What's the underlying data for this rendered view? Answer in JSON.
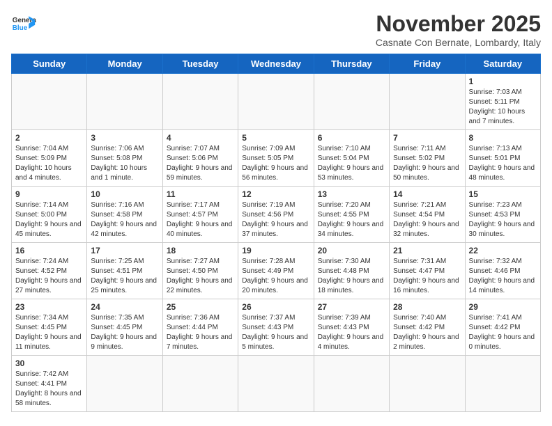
{
  "header": {
    "logo_general": "General",
    "logo_blue": "Blue",
    "month": "November 2025",
    "location": "Casnate Con Bernate, Lombardy, Italy"
  },
  "days_of_week": [
    "Sunday",
    "Monday",
    "Tuesday",
    "Wednesday",
    "Thursday",
    "Friday",
    "Saturday"
  ],
  "weeks": [
    [
      {
        "day": "",
        "info": ""
      },
      {
        "day": "",
        "info": ""
      },
      {
        "day": "",
        "info": ""
      },
      {
        "day": "",
        "info": ""
      },
      {
        "day": "",
        "info": ""
      },
      {
        "day": "",
        "info": ""
      },
      {
        "day": "1",
        "info": "Sunrise: 7:03 AM\nSunset: 5:11 PM\nDaylight: 10 hours and 7 minutes."
      }
    ],
    [
      {
        "day": "2",
        "info": "Sunrise: 7:04 AM\nSunset: 5:09 PM\nDaylight: 10 hours and 4 minutes."
      },
      {
        "day": "3",
        "info": "Sunrise: 7:06 AM\nSunset: 5:08 PM\nDaylight: 10 hours and 1 minute."
      },
      {
        "day": "4",
        "info": "Sunrise: 7:07 AM\nSunset: 5:06 PM\nDaylight: 9 hours and 59 minutes."
      },
      {
        "day": "5",
        "info": "Sunrise: 7:09 AM\nSunset: 5:05 PM\nDaylight: 9 hours and 56 minutes."
      },
      {
        "day": "6",
        "info": "Sunrise: 7:10 AM\nSunset: 5:04 PM\nDaylight: 9 hours and 53 minutes."
      },
      {
        "day": "7",
        "info": "Sunrise: 7:11 AM\nSunset: 5:02 PM\nDaylight: 9 hours and 50 minutes."
      },
      {
        "day": "8",
        "info": "Sunrise: 7:13 AM\nSunset: 5:01 PM\nDaylight: 9 hours and 48 minutes."
      }
    ],
    [
      {
        "day": "9",
        "info": "Sunrise: 7:14 AM\nSunset: 5:00 PM\nDaylight: 9 hours and 45 minutes."
      },
      {
        "day": "10",
        "info": "Sunrise: 7:16 AM\nSunset: 4:58 PM\nDaylight: 9 hours and 42 minutes."
      },
      {
        "day": "11",
        "info": "Sunrise: 7:17 AM\nSunset: 4:57 PM\nDaylight: 9 hours and 40 minutes."
      },
      {
        "day": "12",
        "info": "Sunrise: 7:19 AM\nSunset: 4:56 PM\nDaylight: 9 hours and 37 minutes."
      },
      {
        "day": "13",
        "info": "Sunrise: 7:20 AM\nSunset: 4:55 PM\nDaylight: 9 hours and 34 minutes."
      },
      {
        "day": "14",
        "info": "Sunrise: 7:21 AM\nSunset: 4:54 PM\nDaylight: 9 hours and 32 minutes."
      },
      {
        "day": "15",
        "info": "Sunrise: 7:23 AM\nSunset: 4:53 PM\nDaylight: 9 hours and 30 minutes."
      }
    ],
    [
      {
        "day": "16",
        "info": "Sunrise: 7:24 AM\nSunset: 4:52 PM\nDaylight: 9 hours and 27 minutes."
      },
      {
        "day": "17",
        "info": "Sunrise: 7:25 AM\nSunset: 4:51 PM\nDaylight: 9 hours and 25 minutes."
      },
      {
        "day": "18",
        "info": "Sunrise: 7:27 AM\nSunset: 4:50 PM\nDaylight: 9 hours and 22 minutes."
      },
      {
        "day": "19",
        "info": "Sunrise: 7:28 AM\nSunset: 4:49 PM\nDaylight: 9 hours and 20 minutes."
      },
      {
        "day": "20",
        "info": "Sunrise: 7:30 AM\nSunset: 4:48 PM\nDaylight: 9 hours and 18 minutes."
      },
      {
        "day": "21",
        "info": "Sunrise: 7:31 AM\nSunset: 4:47 PM\nDaylight: 9 hours and 16 minutes."
      },
      {
        "day": "22",
        "info": "Sunrise: 7:32 AM\nSunset: 4:46 PM\nDaylight: 9 hours and 14 minutes."
      }
    ],
    [
      {
        "day": "23",
        "info": "Sunrise: 7:34 AM\nSunset: 4:45 PM\nDaylight: 9 hours and 11 minutes."
      },
      {
        "day": "24",
        "info": "Sunrise: 7:35 AM\nSunset: 4:45 PM\nDaylight: 9 hours and 9 minutes."
      },
      {
        "day": "25",
        "info": "Sunrise: 7:36 AM\nSunset: 4:44 PM\nDaylight: 9 hours and 7 minutes."
      },
      {
        "day": "26",
        "info": "Sunrise: 7:37 AM\nSunset: 4:43 PM\nDaylight: 9 hours and 5 minutes."
      },
      {
        "day": "27",
        "info": "Sunrise: 7:39 AM\nSunset: 4:43 PM\nDaylight: 9 hours and 4 minutes."
      },
      {
        "day": "28",
        "info": "Sunrise: 7:40 AM\nSunset: 4:42 PM\nDaylight: 9 hours and 2 minutes."
      },
      {
        "day": "29",
        "info": "Sunrise: 7:41 AM\nSunset: 4:42 PM\nDaylight: 9 hours and 0 minutes."
      }
    ],
    [
      {
        "day": "30",
        "info": "Sunrise: 7:42 AM\nSunset: 4:41 PM\nDaylight: 8 hours and 58 minutes."
      },
      {
        "day": "",
        "info": ""
      },
      {
        "day": "",
        "info": ""
      },
      {
        "day": "",
        "info": ""
      },
      {
        "day": "",
        "info": ""
      },
      {
        "day": "",
        "info": ""
      },
      {
        "day": "",
        "info": ""
      }
    ]
  ]
}
